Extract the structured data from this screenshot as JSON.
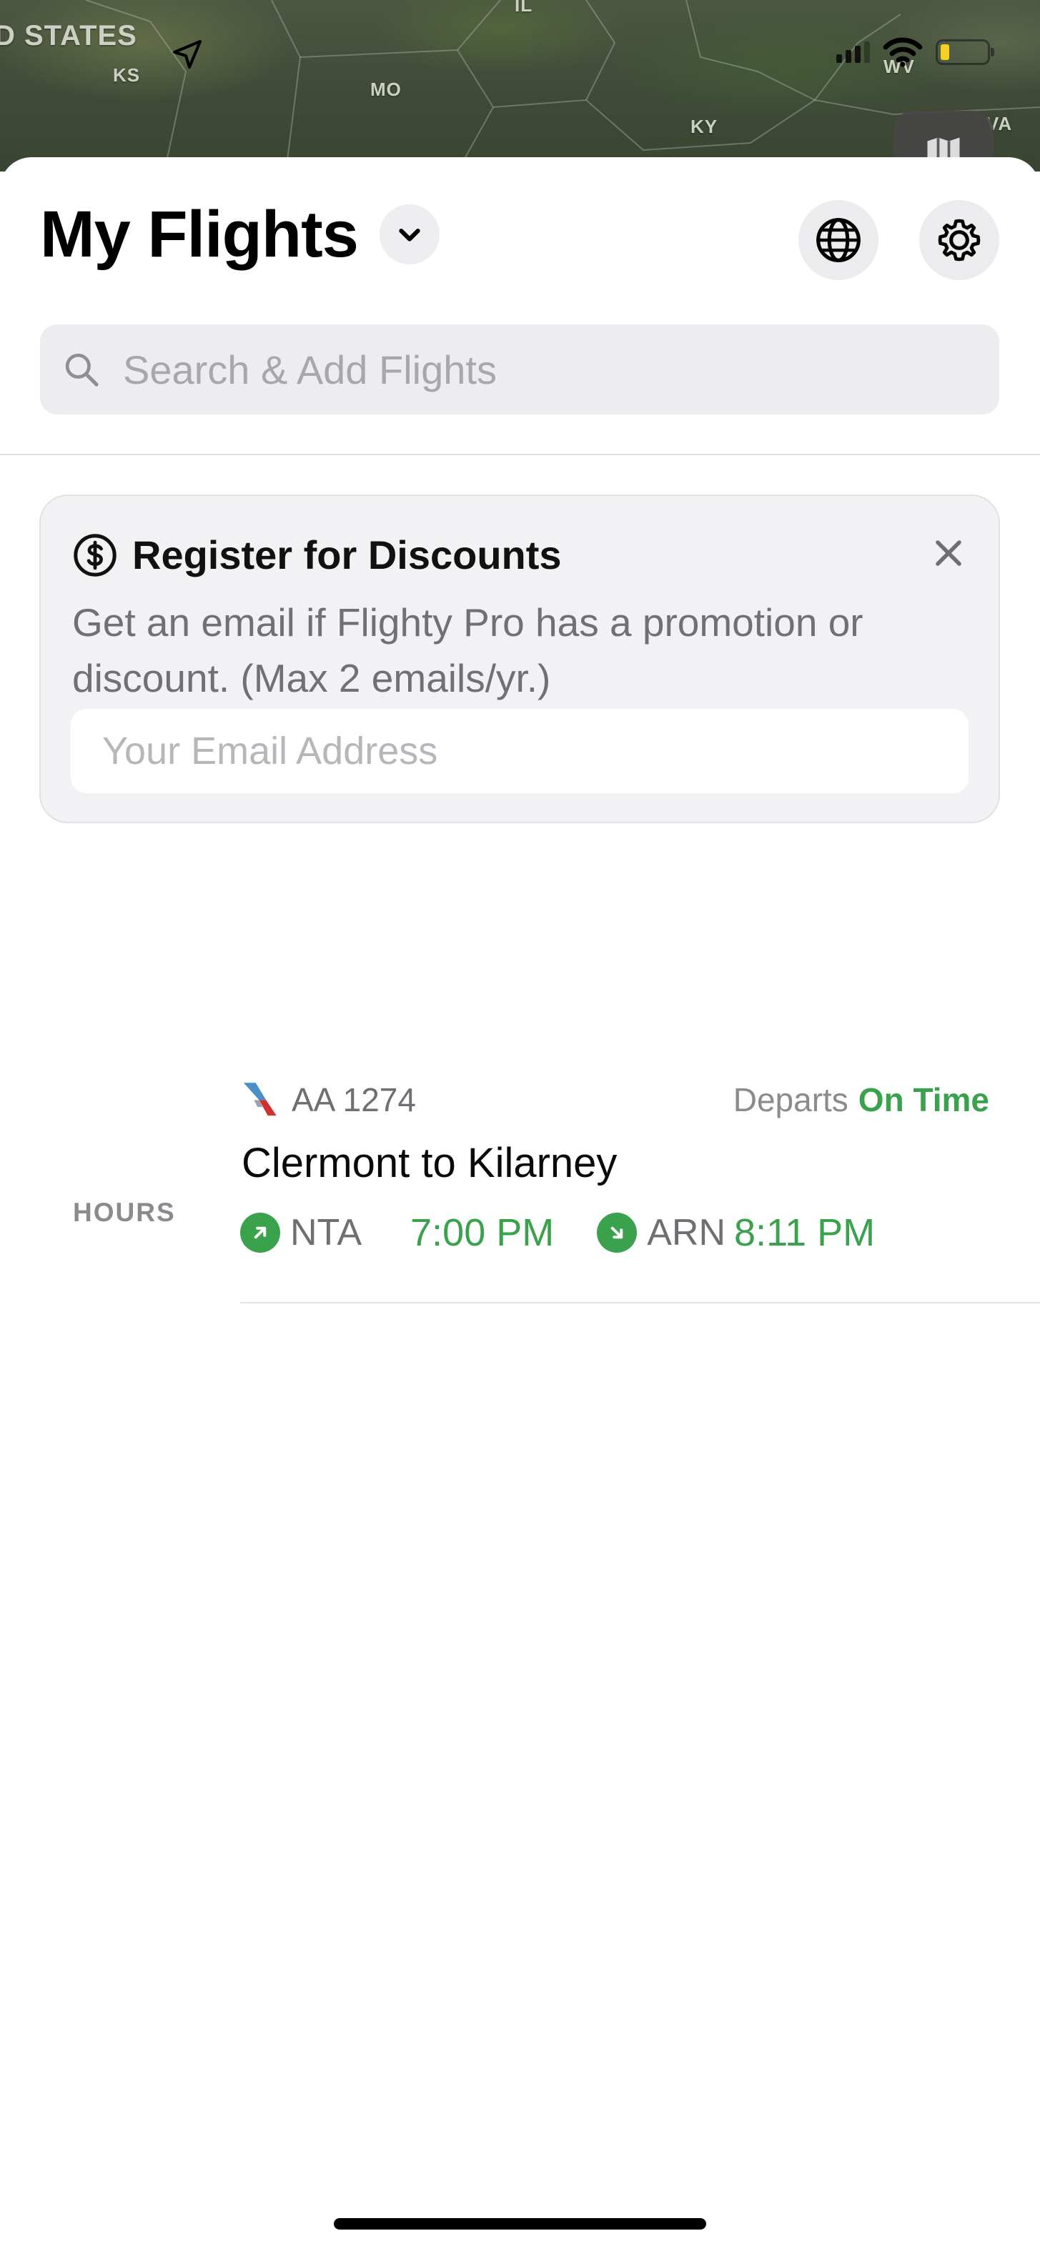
{
  "map": {
    "labels": {
      "country": "D STATES",
      "ks": "KS",
      "mo": "MO",
      "ky": "KY",
      "wv": "WV",
      "il": "IL",
      "va": "VA"
    }
  },
  "header": {
    "title": "My Flights"
  },
  "search": {
    "placeholder": "Search & Add Flights"
  },
  "promo": {
    "title": "Register for Discounts",
    "body": "Get an email if Flighty Pro has a promotion or discount. (Max 2 emails/yr.)",
    "email_placeholder": "Your Email Address"
  },
  "flight": {
    "group_label": "HOURS",
    "flight_number": "AA 1274",
    "departs_label": "Departs",
    "status": "On Time",
    "route": "Clermont to Kilarney",
    "origin_code": "NTA",
    "departure_time": "7:00 PM",
    "destination_code": "ARN",
    "arrival_time": "8:11 PM"
  },
  "colors": {
    "accent_green": "#3aa24d",
    "airline_blue": "#4a90c8",
    "airline_red": "#d0312d"
  },
  "icons": [
    "location-arrow-icon",
    "signal-icon",
    "wifi-icon",
    "battery-icon",
    "map-icon",
    "chevron-down-icon",
    "globe-icon",
    "gear-icon",
    "search-icon",
    "dollar-circle-icon",
    "close-icon",
    "airline-logo",
    "departure-arrow-icon",
    "arrival-arrow-icon"
  ]
}
